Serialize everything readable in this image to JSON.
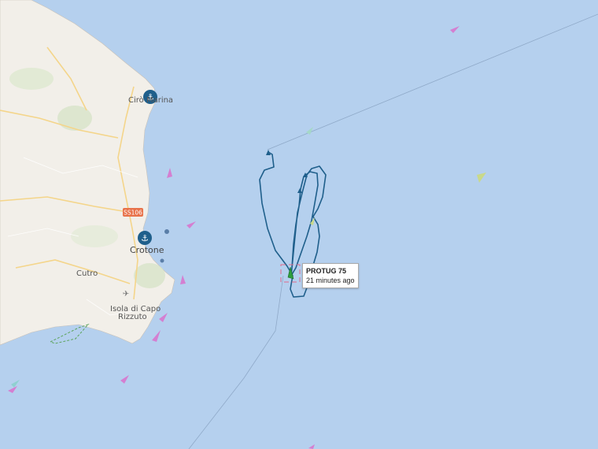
{
  "map": {
    "places": {
      "ciro_marina": "Cirò Marina",
      "crotone": "Crotone",
      "cutro": "Cutro",
      "isola_line1": "Isola di Capo",
      "isola_line2": "Rizzuto",
      "road_shield": "SS106"
    },
    "selected_vessel": {
      "name": "PROTUG 75",
      "last_seen": "21 minutes ago"
    },
    "colors": {
      "sea": "#b5d0ee",
      "land": "#f2efe9",
      "track": "#1f5f8b",
      "port_marker": "#1f5f8b",
      "vessel_selected": "#2e9e3e",
      "vessel_other": "#d47fd1",
      "vessel_cargo": "#a5d88a",
      "road_shield": "#e8724a"
    },
    "icons": {
      "port": "anchor-icon",
      "airport": "airplane-icon",
      "vessel": "vessel-arrow-icon"
    }
  }
}
